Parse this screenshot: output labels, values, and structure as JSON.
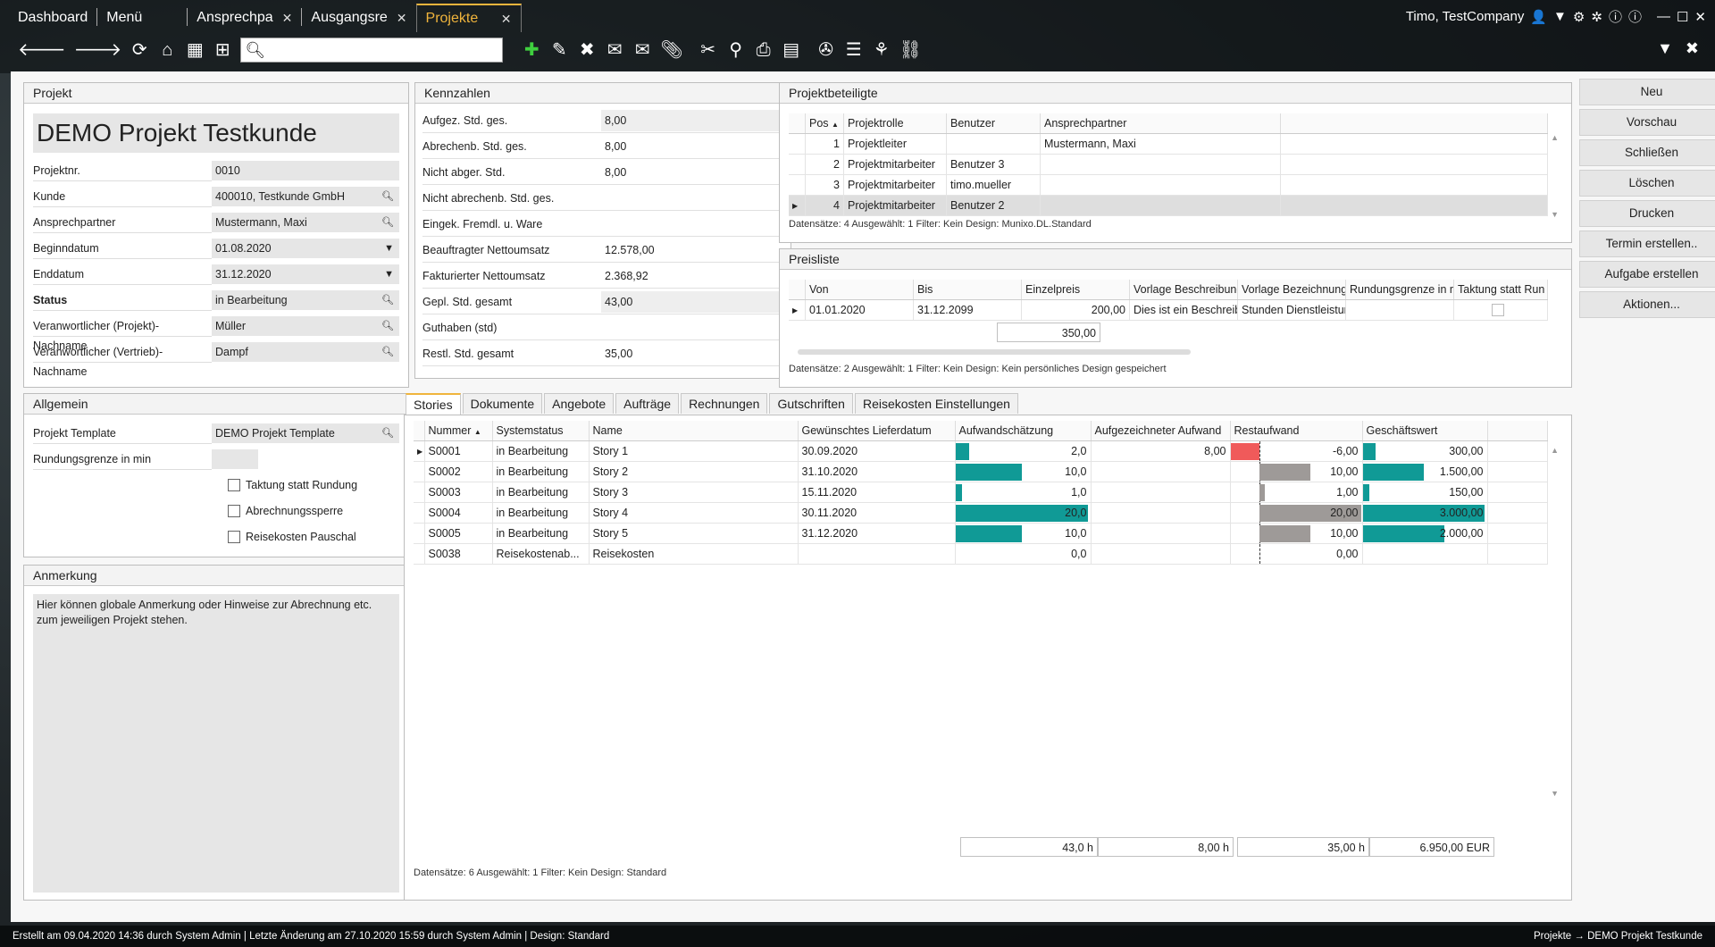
{
  "tabs": [
    {
      "label": "Dashboard"
    },
    {
      "label": "Menü"
    },
    {
      "label": "Ansprechpa",
      "close": "✕"
    },
    {
      "label": "Ausgangsre",
      "close": "✕"
    },
    {
      "label": "Projekte",
      "close": "✕"
    }
  ],
  "user": {
    "name": "Timo, TestCompany"
  },
  "search": {
    "placeholder": ""
  },
  "projekt": {
    "header": "Projekt",
    "title": "DEMO Projekt Testkunde",
    "fields": [
      {
        "label": "Projektnr.",
        "value": "0010"
      },
      {
        "label": "Kunde",
        "value": "400010, Testkunde GmbH"
      },
      {
        "label": "Ansprechpartner",
        "value": "Mustermann, Maxi"
      },
      {
        "label": "Beginndatum",
        "value": "01.08.2020"
      },
      {
        "label": "Enddatum",
        "value": "31.12.2020"
      },
      {
        "label": "Status",
        "value": "in Bearbeitung"
      },
      {
        "label": "Veranwortlicher (Projekt)-Nachname",
        "value": "Müller"
      },
      {
        "label": "Veranwortlicher (Vertrieb)-Nachname",
        "value": "Dampf"
      }
    ]
  },
  "allgemein": {
    "header": "Allgemein",
    "template_label": "Projekt Template",
    "template_value": "DEMO Projekt Template",
    "rundung_label": "Rundungsgrenze in min",
    "rundung_value": "",
    "checkboxes": [
      "Taktung statt Rundung",
      "Abrechnungssperre",
      "Reisekosten Pauschal"
    ]
  },
  "anmerkung": {
    "header": "Anmerkung",
    "text": "Hier können globale Anmerkung oder Hinweise zur Abrechnung etc. zum jeweiligen Projekt stehen."
  },
  "kennzahlen": {
    "header": "Kennzahlen",
    "rows": [
      {
        "label": "Aufgez. Std. ges.",
        "value": "8,00"
      },
      {
        "label": "Abrechenb. Std. ges.",
        "value": "8,00"
      },
      {
        "label": "Nicht abger. Std.",
        "value": "8,00"
      },
      {
        "label": "Nicht abrechenb. Std. ges.",
        "value": ""
      },
      {
        "label": "Eingek. Fremdl. u. Ware",
        "value": ""
      },
      {
        "label": "Beauftragter Nettoumsatz",
        "value": "12.578,00"
      },
      {
        "label": "Fakturierter Nettoumsatz",
        "value": "2.368,92"
      },
      {
        "label": "Gepl. Std. gesamt",
        "value": "43,00"
      },
      {
        "label": "Guthaben (std)",
        "value": ""
      },
      {
        "label": "Restl. Std. gesamt",
        "value": "35,00"
      }
    ]
  },
  "beteiligte": {
    "header": "Projektbeteiligte",
    "columns": [
      "Pos",
      "Projektrolle",
      "Benutzer",
      "Ansprechpartner"
    ],
    "rows": [
      [
        "1",
        "Projektleiter",
        "",
        "Mustermann, Maxi"
      ],
      [
        "2",
        "Projektmitarbeiter",
        "Benutzer 3",
        ""
      ],
      [
        "3",
        "Projektmitarbeiter",
        "timo.mueller",
        ""
      ],
      [
        "4",
        "Projektmitarbeiter",
        "Benutzer 2",
        ""
      ]
    ],
    "footer": "Datensätze: 4 Ausgewählt: 1 Filter: Kein Design: Munixo.DL.Standard"
  },
  "preisliste": {
    "header": "Preisliste",
    "columns": [
      "Von",
      "Bis",
      "Einzelpreis",
      "Vorlage Beschreibung",
      "Vorlage Bezeichnung",
      "Rundungsgrenze in m",
      "Taktung statt Run"
    ],
    "rows": [
      [
        "01.01.2020",
        "31.12.2099",
        "200,00",
        "Dies ist ein Beschreibu",
        "Stunden Dienstleistur",
        "",
        ""
      ]
    ],
    "sum": "350,00",
    "footer": "Datensätze: 2 Ausgewählt: 1 Filter: Kein Design: Kein persönliches Design gespeichert"
  },
  "buttons": [
    "Neu",
    "Vorschau",
    "Schließen",
    "Löschen",
    "Drucken",
    "Termin erstellen..",
    "Aufgabe erstellen",
    "Aktionen..."
  ],
  "lower_tabs": [
    "Stories",
    "Dokumente",
    "Angebote",
    "Aufträge",
    "Rechnungen",
    "Gutschriften",
    "Reisekosten Einstellungen"
  ],
  "stories": {
    "columns": [
      "Nummer",
      "Systemstatus",
      "Name",
      "Gewünschtes Lieferdatum",
      "Aufwandschätzung",
      "Aufgezeichneter Aufwand",
      "Restaufwand",
      "Geschäftswert"
    ],
    "rows": [
      {
        "nummer": "S0001",
        "status": "in Bearbeitung",
        "name": "Story 1",
        "datum": "30.09.2020",
        "aufwand": "2,0",
        "aufwand_v": 2,
        "aufgez": "8,00",
        "rest": "-6,00",
        "rest_v": -6,
        "wert": "300,00",
        "wert_v": 300
      },
      {
        "nummer": "S0002",
        "status": "in Bearbeitung",
        "name": "Story 2",
        "datum": "31.10.2020",
        "aufwand": "10,0",
        "aufwand_v": 10,
        "aufgez": "",
        "rest": "10,00",
        "rest_v": 10,
        "wert": "1.500,00",
        "wert_v": 1500
      },
      {
        "nummer": "S0003",
        "status": "in Bearbeitung",
        "name": "Story 3",
        "datum": "15.11.2020",
        "aufwand": "1,0",
        "aufwand_v": 1,
        "aufgez": "",
        "rest": "1,00",
        "rest_v": 1,
        "wert": "150,00",
        "wert_v": 150
      },
      {
        "nummer": "S0004",
        "status": "in Bearbeitung",
        "name": "Story 4",
        "datum": "30.11.2020",
        "aufwand": "20,0",
        "aufwand_v": 20,
        "aufgez": "",
        "rest": "20,00",
        "rest_v": 20,
        "wert": "3.000,00",
        "wert_v": 3000
      },
      {
        "nummer": "S0005",
        "status": "in Bearbeitung",
        "name": "Story 5",
        "datum": "31.12.2020",
        "aufwand": "10,0",
        "aufwand_v": 10,
        "aufgez": "",
        "rest": "10,00",
        "rest_v": 10,
        "wert": "2.000,00",
        "wert_v": 2000
      },
      {
        "nummer": "S0038",
        "status": "Reisekostenab...",
        "name": "Reisekosten",
        "datum": "",
        "aufwand": "0,0",
        "aufwand_v": 0,
        "aufgez": "",
        "rest": "0,00",
        "rest_v": 0,
        "wert": "",
        "wert_v": 0
      }
    ],
    "totals": {
      "aufwand": "43,0 h",
      "aufgez": "8,00 h",
      "rest": "35,00 h",
      "wert": "6.950,00 EUR"
    },
    "footer": "Datensätze: 6 Ausgewählt: 1 Filter: Kein Design: Standard"
  },
  "status_left": "Erstellt am 09.04.2020 14:36 durch System Admin | Letzte Änderung am 27.10.2020 15:59 durch System Admin | Design: Standard",
  "status_right": {
    "module": "Projekte",
    "record": "DEMO Projekt Testkunde"
  },
  "colors": {
    "accent": "#f0b43c",
    "teal": "#109a96",
    "red": "#f05a5a",
    "grey_bar": "#9e9a98"
  }
}
